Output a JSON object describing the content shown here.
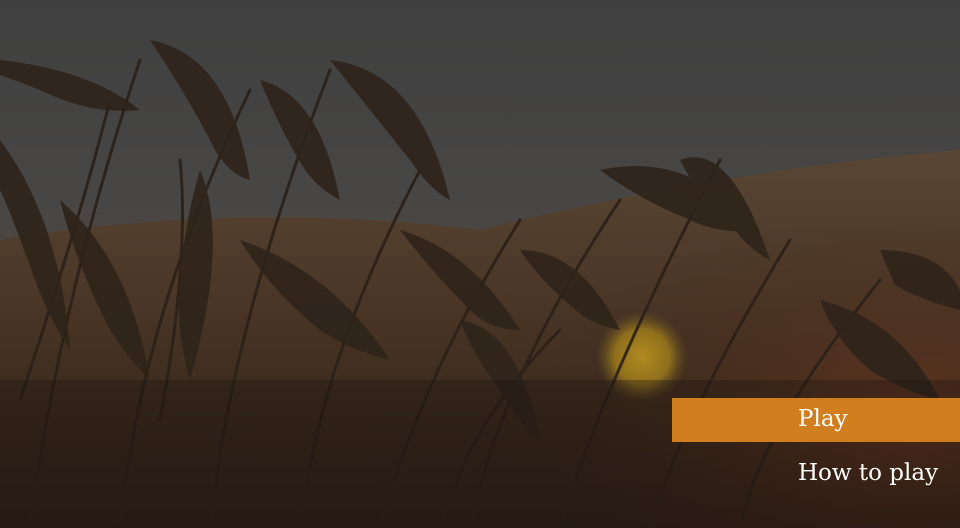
{
  "background": {
    "subject": "wheat-field-at-sunset",
    "overlay_color": "#2b2826",
    "accent_color": "#d07e1e"
  },
  "menu": {
    "items": [
      {
        "id": "play",
        "label": "Play",
        "active": true
      },
      {
        "id": "how-to-play",
        "label": "How to play",
        "active": false
      }
    ]
  }
}
